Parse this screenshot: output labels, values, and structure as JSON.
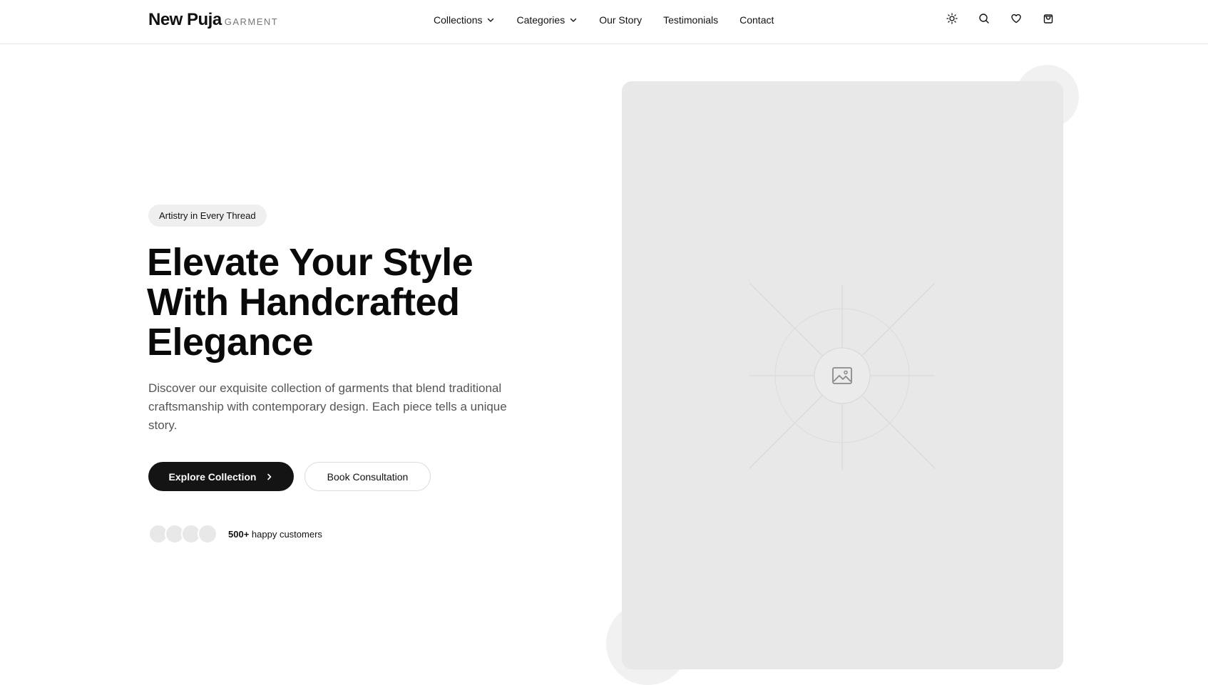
{
  "brand": {
    "name": "New Puja",
    "sub": "GARMENT"
  },
  "nav": {
    "items": [
      {
        "label": "Collections",
        "dropdown": true
      },
      {
        "label": "Categories",
        "dropdown": true
      },
      {
        "label": "Our Story",
        "dropdown": false
      },
      {
        "label": "Testimonials",
        "dropdown": false
      },
      {
        "label": "Contact",
        "dropdown": false
      }
    ]
  },
  "header_icons": [
    "sun-icon",
    "search-icon",
    "heart-icon",
    "shopping-bag-icon"
  ],
  "hero": {
    "badge": "Artistry in Every Thread",
    "headline": {
      "line1": "Elevate Your Style",
      "line2": "With Handcrafted",
      "line3": "Elegance"
    },
    "description": "Discover our exquisite collection of garments that blend traditional craftsmanship with contemporary design. Each piece tells a unique story.",
    "primary_cta": "Explore Collection",
    "secondary_cta": "Book Consultation",
    "social_proof": {
      "count": "500+",
      "text": "happy customers"
    }
  },
  "colors": {
    "primary": "#141414",
    "background": "#ffffff",
    "muted_text": "#555555",
    "placeholder_bg": "#e8e8e8"
  }
}
